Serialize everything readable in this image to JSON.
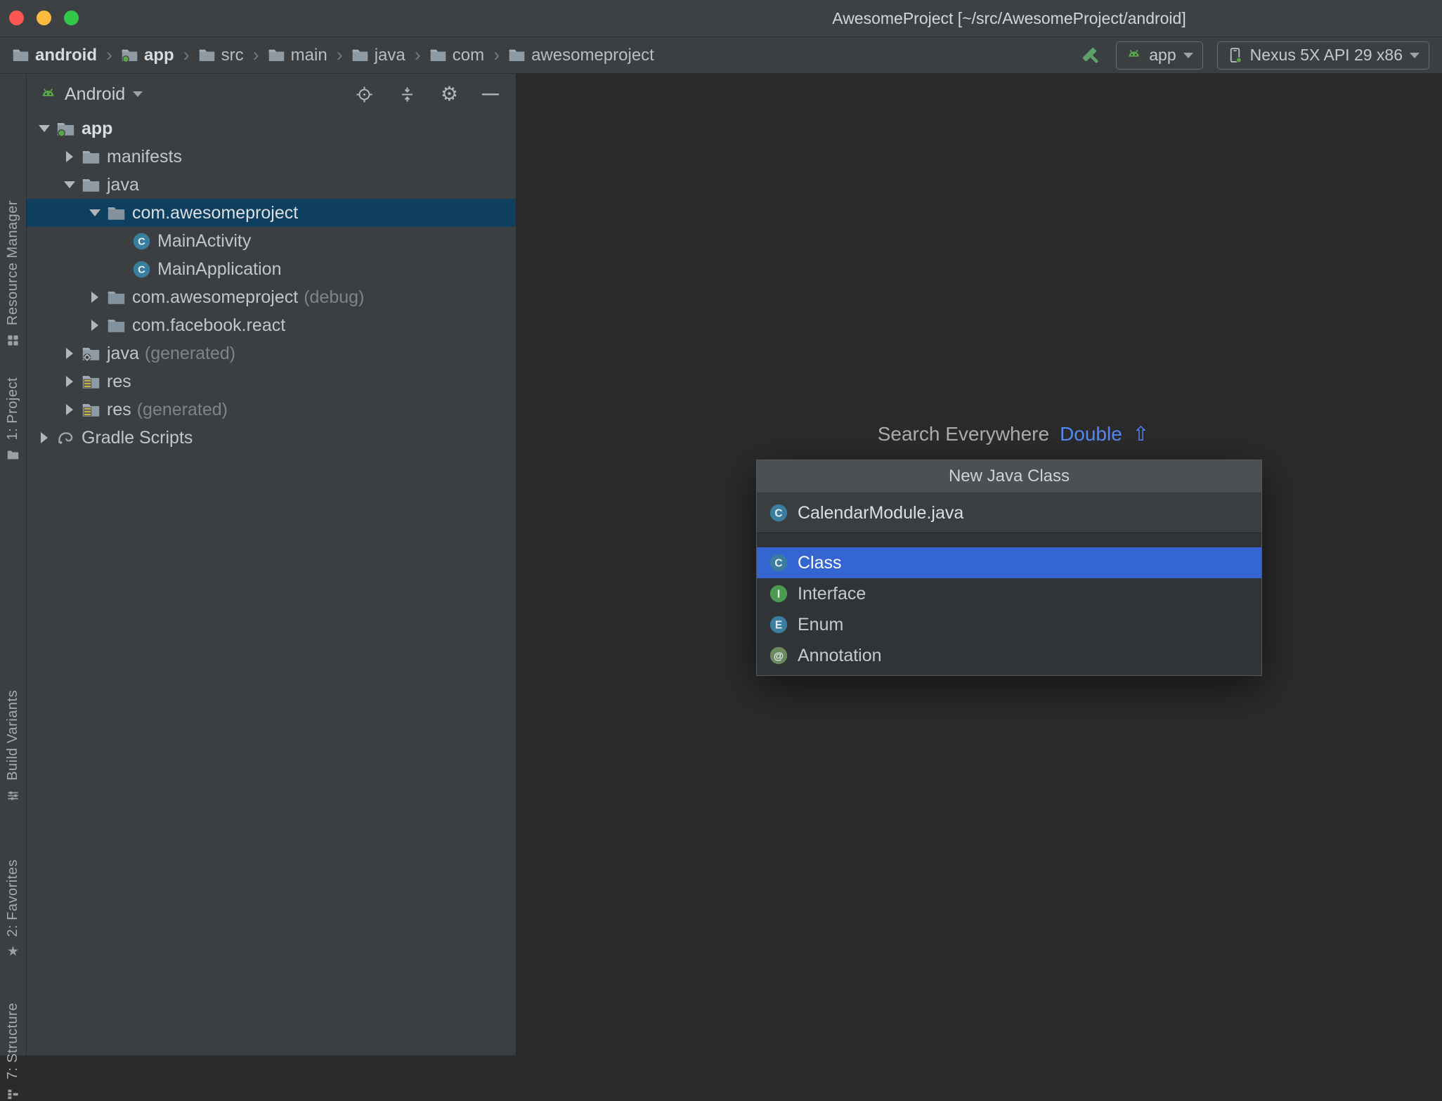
{
  "window": {
    "title": "AwesomeProject [~/src/AwesomeProject/android]"
  },
  "icons": {
    "settings": "⚙",
    "hide": "—",
    "star": "★",
    "separator": "›"
  },
  "colors": {
    "selection_blue": "#3565d0",
    "tree_selection_navy": "#0f3f5f",
    "hint_blue": "#548af7",
    "android_green": "#57a64a",
    "panel_background": "#3c3f41",
    "editor_background": "#2b2b2b"
  },
  "breadcrumbs": {
    "items": [
      {
        "label": "android",
        "icon": "folder"
      },
      {
        "label": "app",
        "icon": "module"
      },
      {
        "label": "src",
        "icon": "folder"
      },
      {
        "label": "main",
        "icon": "folder"
      },
      {
        "label": "java",
        "icon": "folder"
      },
      {
        "label": "com",
        "icon": "folder"
      },
      {
        "label": "awesomeproject",
        "icon": "folder"
      }
    ]
  },
  "run_controls": {
    "config_label": "app",
    "device_label": "Nexus 5X API 29 x86"
  },
  "tool_strip": {
    "items": [
      "Resource Manager",
      "1: Project",
      "Build Variants",
      "2: Favorites",
      "7: Structure"
    ]
  },
  "project_panel": {
    "view_selector": "Android",
    "tree": [
      {
        "label": "app",
        "suffix": "",
        "level": 0,
        "state": "expanded",
        "icon": "module",
        "selected": false,
        "bold": true
      },
      {
        "label": "manifests",
        "suffix": "",
        "level": 1,
        "state": "collapsed",
        "icon": "folder",
        "selected": false
      },
      {
        "label": "java",
        "suffix": "",
        "level": 1,
        "state": "expanded",
        "icon": "folder",
        "selected": false
      },
      {
        "label": "com.awesomeproject",
        "suffix": "",
        "level": 2,
        "state": "expanded",
        "icon": "package",
        "selected": true
      },
      {
        "label": "MainActivity",
        "suffix": "",
        "level": 3,
        "state": "leaf",
        "icon": "class",
        "selected": false
      },
      {
        "label": "MainApplication",
        "suffix": "",
        "level": 3,
        "state": "leaf",
        "icon": "class",
        "selected": false
      },
      {
        "label": "com.awesomeproject",
        "suffix": "(debug)",
        "level": 2,
        "state": "collapsed",
        "icon": "package",
        "selected": false
      },
      {
        "label": "com.facebook.react",
        "suffix": "",
        "level": 2,
        "state": "collapsed",
        "icon": "package",
        "selected": false
      },
      {
        "label": "java",
        "suffix": "(generated)",
        "level": 1,
        "state": "collapsed",
        "icon": "folder-gen",
        "selected": false
      },
      {
        "label": "res",
        "suffix": "",
        "level": 1,
        "state": "collapsed",
        "icon": "res",
        "selected": false
      },
      {
        "label": "res",
        "suffix": "(generated)",
        "level": 1,
        "state": "collapsed",
        "icon": "res",
        "selected": false
      },
      {
        "label": "Gradle Scripts",
        "suffix": "",
        "level": 0,
        "state": "collapsed",
        "icon": "gradle",
        "selected": false
      }
    ]
  },
  "editor_hint": {
    "text": "Search Everywhere",
    "shortcut": "Double",
    "shortcut_symbol": "⇧"
  },
  "popup": {
    "title": "New Java Class",
    "input_value": "CalendarModule.java",
    "options": [
      {
        "label": "Class",
        "kind": "class",
        "selected": true
      },
      {
        "label": "Interface",
        "kind": "interface",
        "selected": false
      },
      {
        "label": "Enum",
        "kind": "enum",
        "selected": false
      },
      {
        "label": "Annotation",
        "kind": "annotation",
        "selected": false
      }
    ]
  }
}
